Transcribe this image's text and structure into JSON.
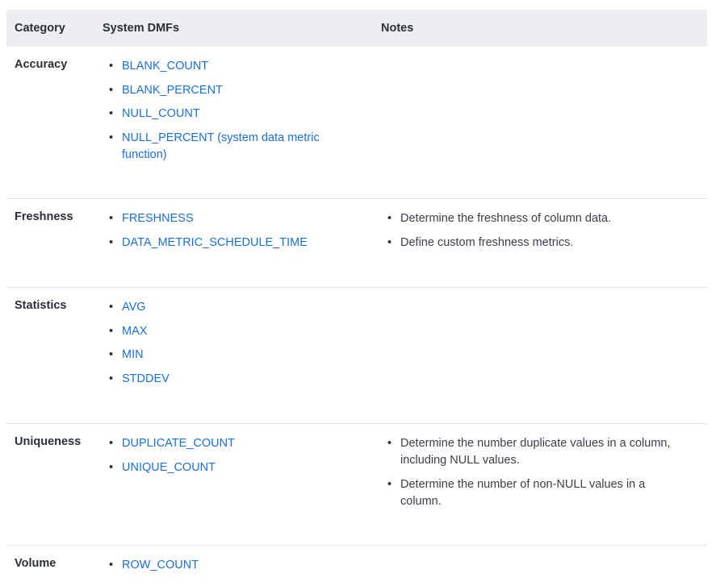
{
  "headers": {
    "category": "Category",
    "dmfs": "System DMFs",
    "notes": "Notes"
  },
  "rows": [
    {
      "category": "Accuracy",
      "dmfs": [
        "BLANK_COUNT",
        "BLANK_PERCENT",
        "NULL_COUNT",
        "NULL_PERCENT (system data metric function)"
      ],
      "notes": []
    },
    {
      "category": "Freshness",
      "dmfs": [
        "FRESHNESS",
        "DATA_METRIC_SCHEDULE_TIME"
      ],
      "notes": [
        "Determine the freshness of column data.",
        "Define custom freshness metrics."
      ]
    },
    {
      "category": "Statistics",
      "dmfs": [
        "AVG",
        "MAX",
        "MIN",
        "STDDEV"
      ],
      "notes": []
    },
    {
      "category": "Uniqueness",
      "dmfs": [
        "DUPLICATE_COUNT",
        "UNIQUE_COUNT"
      ],
      "notes": [
        "Determine the number duplicate values in a column, including NULL values.",
        "Determine the number of non-NULL values in a column."
      ]
    },
    {
      "category": "Volume",
      "dmfs": [
        "ROW_COUNT"
      ],
      "notes": []
    }
  ],
  "colors": {
    "link": "#1a6fd6",
    "header_bg": "#eceef1",
    "divider": "#dfe2e6"
  }
}
